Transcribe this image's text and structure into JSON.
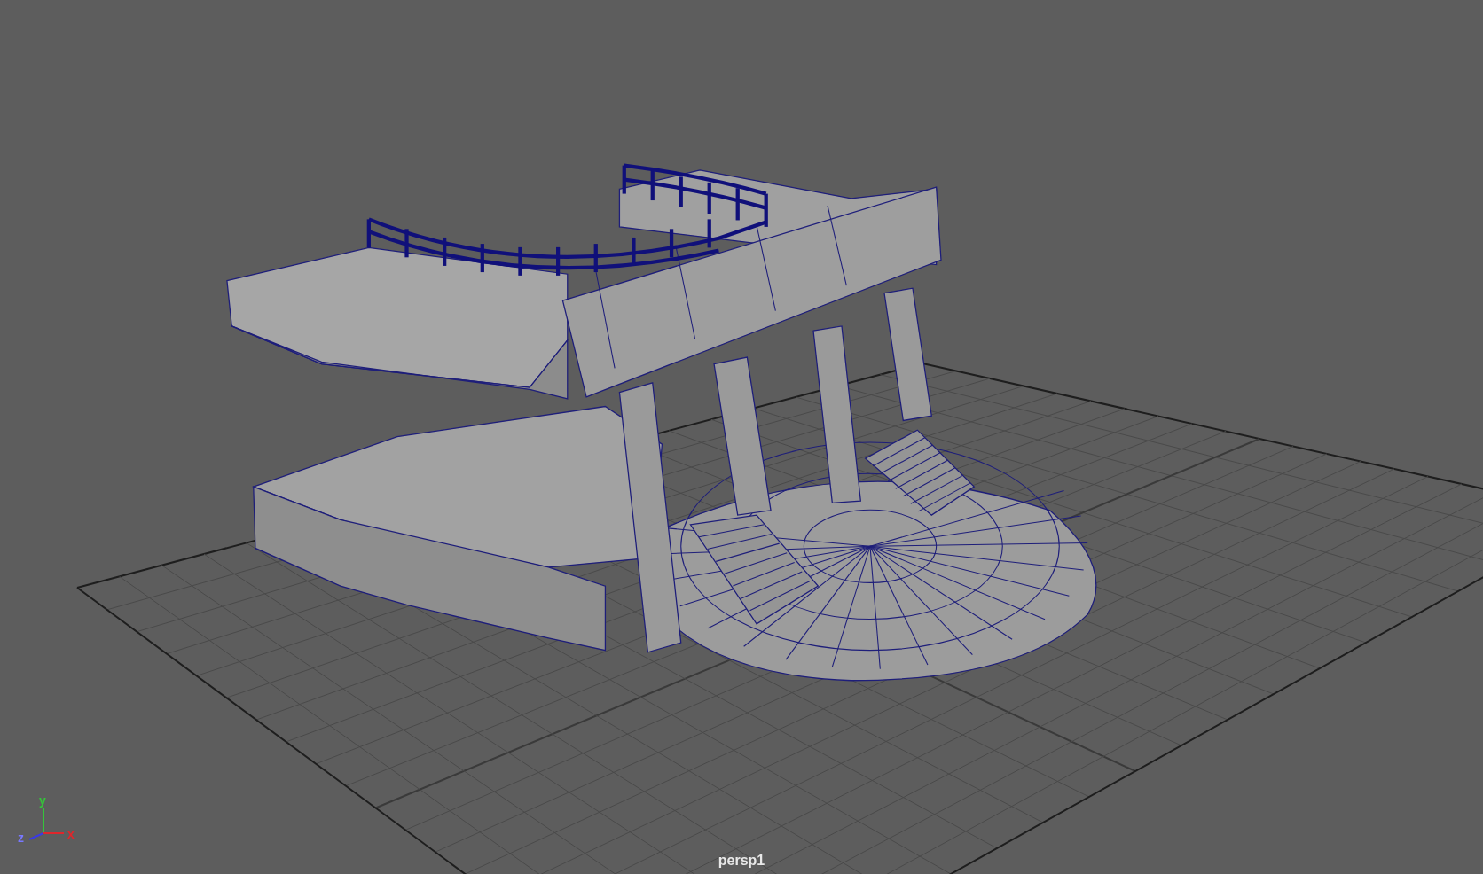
{
  "viewport": {
    "camera_label": "persp1",
    "axes": [
      {
        "text": "y",
        "color": "#35c43a"
      },
      {
        "text": "z",
        "color": "#7878ff"
      },
      {
        "text": "x",
        "color": "#e0262b"
      }
    ]
  }
}
